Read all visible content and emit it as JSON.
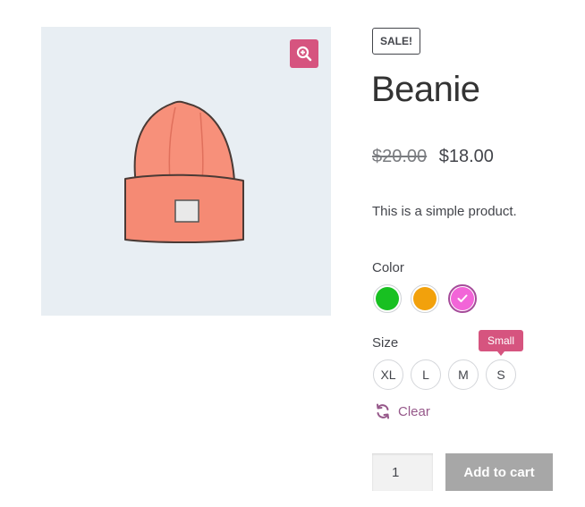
{
  "product": {
    "badge": "SALE!",
    "title": "Beanie",
    "price_old": "$20.00",
    "price_new": "$18.00",
    "description": "This is a simple product."
  },
  "gallery": {
    "zoom_icon": "zoom-in-icon",
    "image_subject": "beanie"
  },
  "attributes": {
    "color_label": "Color",
    "colors": [
      {
        "name": "green",
        "hex": "#18c021",
        "selected": false
      },
      {
        "name": "orange",
        "hex": "#f2a10c",
        "selected": false
      },
      {
        "name": "pink",
        "hex": "#f265d8",
        "selected": true
      }
    ],
    "size_label": "Size",
    "sizes": [
      "XL",
      "L",
      "M",
      "S"
    ],
    "tooltip": "Small",
    "clear_label": "Clear"
  },
  "cart": {
    "quantity": "1",
    "add_label": "Add to cart"
  },
  "colors": {
    "accent": "#d6547f",
    "link": "#96588a",
    "button_disabled": "#a7a7a7",
    "gallery_bg": "#e8eef3"
  }
}
